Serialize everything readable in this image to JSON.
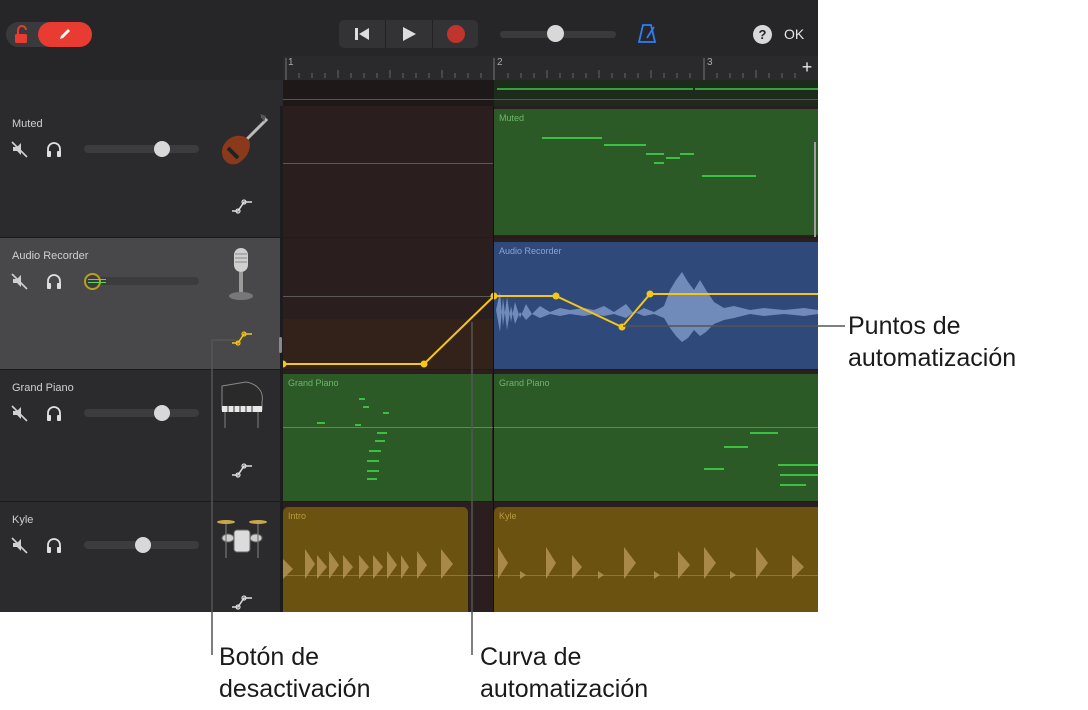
{
  "toolbar": {
    "help_label": "?",
    "ok_label": "OK"
  },
  "ruler": {
    "markers": [
      "1",
      "2",
      "3"
    ],
    "add_label": "+"
  },
  "tracks": [
    {
      "name": "Muted",
      "instrument": "bass-guitar-icon",
      "volume": 0.68
    },
    {
      "name": "Audio Recorder",
      "instrument": "microphone-icon",
      "volume": 0.1,
      "selected": true
    },
    {
      "name": "Grand Piano",
      "instrument": "grand-piano-icon",
      "volume": 0.68
    },
    {
      "name": "Kyle",
      "instrument": "drum-kit-icon",
      "volume": 0.5
    }
  ],
  "regions": {
    "muted": "Muted",
    "audio": "Audio Recorder",
    "piano_a": "Grand Piano",
    "piano_b": "Grand Piano",
    "drums_intro": "Intro",
    "drums_kyle": "Kyle"
  },
  "callouts": {
    "points_line1": "Puntos de",
    "points_line2": "automatización",
    "button_line1": "Botón de",
    "button_line2": "desactivación",
    "curve_line1": "Curva de",
    "curve_line2": "automatización"
  },
  "colors": {
    "accent_red": "#e83b32",
    "automation_yellow": "#f5c518",
    "midi_green": "#2c5a27",
    "audio_blue": "#2f4a7a",
    "drummer_gold": "#6b5210",
    "metronome_blue": "#2f7df6"
  }
}
